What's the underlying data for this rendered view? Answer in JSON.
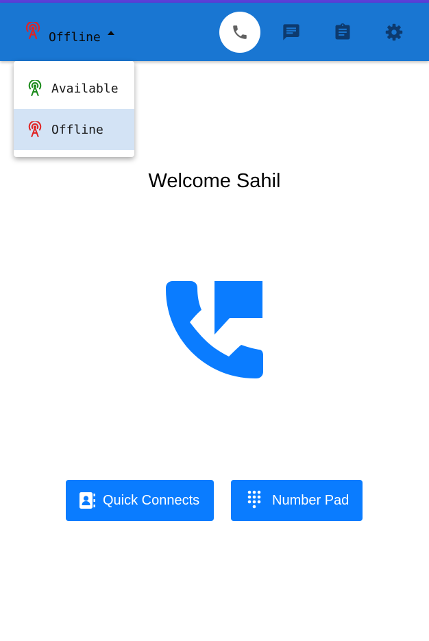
{
  "header": {
    "status": {
      "current": "Offline",
      "icon": "broadcast-tower-icon",
      "color": "#e02424"
    },
    "nav": [
      {
        "name": "phone",
        "icon": "phone-icon",
        "active": true
      },
      {
        "name": "chat",
        "icon": "chat-icon",
        "active": false
      },
      {
        "name": "tasks",
        "icon": "clipboard-icon",
        "active": false
      },
      {
        "name": "settings",
        "icon": "gear-icon",
        "active": false
      }
    ]
  },
  "status_menu": {
    "items": [
      {
        "label": "Available",
        "icon": "broadcast-tower-icon",
        "color": "#1a8a1a",
        "selected": false
      },
      {
        "label": "Offline",
        "icon": "broadcast-tower-icon",
        "color": "#e02424",
        "selected": true
      }
    ]
  },
  "main": {
    "welcome": "Welcome Sahil",
    "hero_icon": "phone-chat-icon",
    "buttons": {
      "quick_connects": "Quick Connects",
      "number_pad": "Number Pad"
    }
  },
  "colors": {
    "appbar": "#1976d2",
    "accent": "#0a7cff",
    "nav_icon": "#0d3a6e",
    "selected_item": "#d3e3f5"
  }
}
